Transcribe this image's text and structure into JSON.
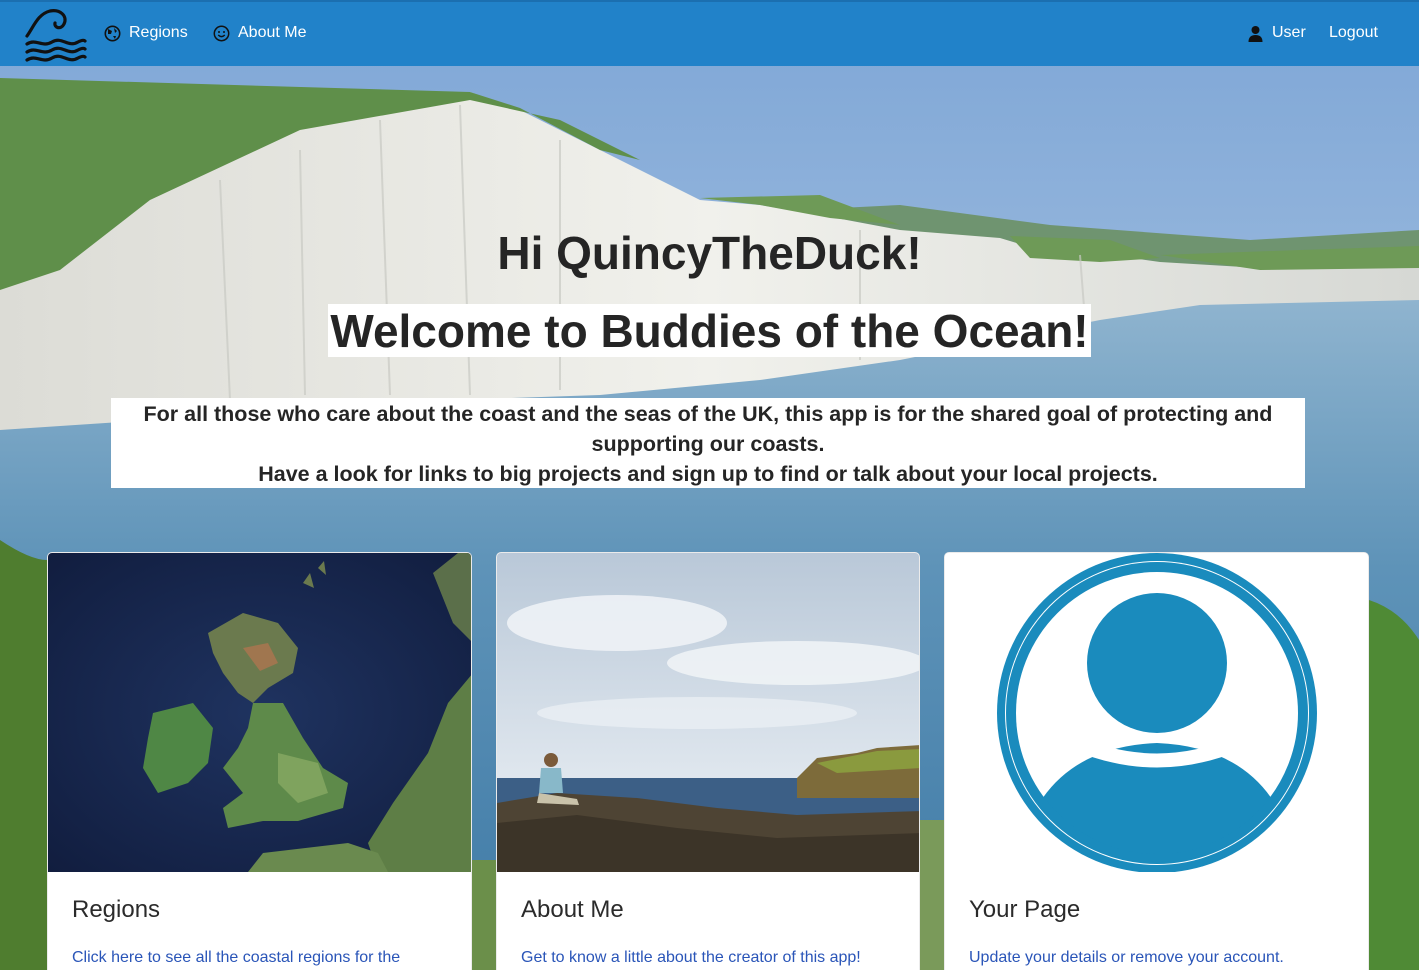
{
  "nav": {
    "brand_icon": "wave-logo-icon",
    "regions_label": "Regions",
    "regions_icon": "globe-icon",
    "about_label": "About Me",
    "about_icon": "smiley-icon",
    "user_label": "User",
    "user_icon": "person-icon",
    "logout_label": "Logout",
    "color": "#2182c9"
  },
  "hero": {
    "greeting": "Hi QuincyTheDuck!",
    "title": "Welcome to Buddies of the Ocean!",
    "description_line1": "For all those who care about the coast and the seas of the UK, this app is for the shared goal of protecting and supporting our coasts.",
    "description_line2": "Have a look for links to big projects and sign up to find or talk about your local projects."
  },
  "cards": [
    {
      "title": "Regions",
      "link_text": "Click here to see all the coastal regions for the",
      "image": "uk-satellite-map"
    },
    {
      "title": "About Me",
      "link_text": "Get to know a little about the creator of this app!",
      "image": "coast-person-photo"
    },
    {
      "title": "Your Page",
      "link_text": "Update your details or remove your account.",
      "image": "user-avatar-icon"
    }
  ],
  "colors": {
    "link": "#2a55b8",
    "avatar": "#1a8bbd"
  }
}
